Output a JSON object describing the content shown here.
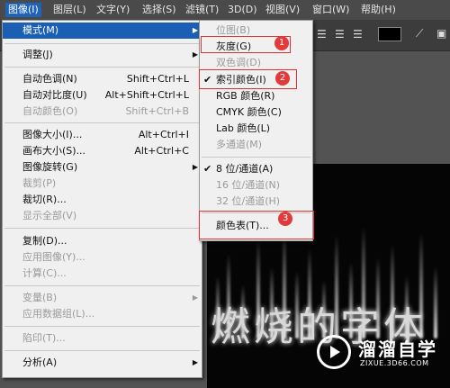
{
  "menubar": {
    "items": [
      "图像(I)",
      "图层(L)",
      "文字(Y)",
      "选择(S)",
      "滤镜(T)",
      "3D(D)",
      "视图(V)",
      "窗口(W)",
      "帮助(H)"
    ]
  },
  "image_menu": {
    "items": [
      {
        "label": "模式(M)",
        "shortcut": ""
      },
      {
        "label": "调整(J)",
        "shortcut": ""
      },
      {
        "label": "自动色调(N)",
        "shortcut": "Shift+Ctrl+L"
      },
      {
        "label": "自动对比度(U)",
        "shortcut": "Alt+Shift+Ctrl+L"
      },
      {
        "label": "自动颜色(O)",
        "shortcut": "Shift+Ctrl+B"
      },
      {
        "label": "图像大小(I)...",
        "shortcut": "Alt+Ctrl+I"
      },
      {
        "label": "画布大小(S)...",
        "shortcut": "Alt+Ctrl+C"
      },
      {
        "label": "图像旋转(G)",
        "shortcut": ""
      },
      {
        "label": "裁剪(P)",
        "shortcut": ""
      },
      {
        "label": "裁切(R)...",
        "shortcut": ""
      },
      {
        "label": "显示全部(V)",
        "shortcut": ""
      },
      {
        "label": "复制(D)...",
        "shortcut": ""
      },
      {
        "label": "应用图像(Y)...",
        "shortcut": ""
      },
      {
        "label": "计算(C)...",
        "shortcut": ""
      },
      {
        "label": "变量(B)",
        "shortcut": ""
      },
      {
        "label": "应用数据组(L)...",
        "shortcut": ""
      },
      {
        "label": "陷印(T)...",
        "shortcut": ""
      },
      {
        "label": "分析(A)",
        "shortcut": ""
      }
    ]
  },
  "mode_submenu": {
    "items": [
      {
        "label": "位图(B)"
      },
      {
        "label": "灰度(G)"
      },
      {
        "label": "双色调(D)"
      },
      {
        "label": "索引颜色(I)"
      },
      {
        "label": "RGB 颜色(R)"
      },
      {
        "label": "CMYK 颜色(C)"
      },
      {
        "label": "Lab 颜色(L)"
      },
      {
        "label": "多通道(M)"
      },
      {
        "label": "8 位/通道(A)"
      },
      {
        "label": "16 位/通道(N)"
      },
      {
        "label": "32 位/通道(H)"
      },
      {
        "label": "颜色表(T)..."
      }
    ],
    "check": "✔"
  },
  "annotations": {
    "badges": [
      "1",
      "2",
      "3"
    ],
    "color": "#e03030"
  },
  "canvas": {
    "text": "燃烧的字体"
  },
  "watermark": {
    "brand": "溜溜自学",
    "url": "ZIXUE.3D66.COM"
  },
  "icons": {
    "submenu_arrow": "▶",
    "play": "play-icon"
  },
  "colors": {
    "highlight": "#1a5fb4",
    "menubar": "#4a4a4a",
    "menu_bg": "#f0f0f0"
  }
}
